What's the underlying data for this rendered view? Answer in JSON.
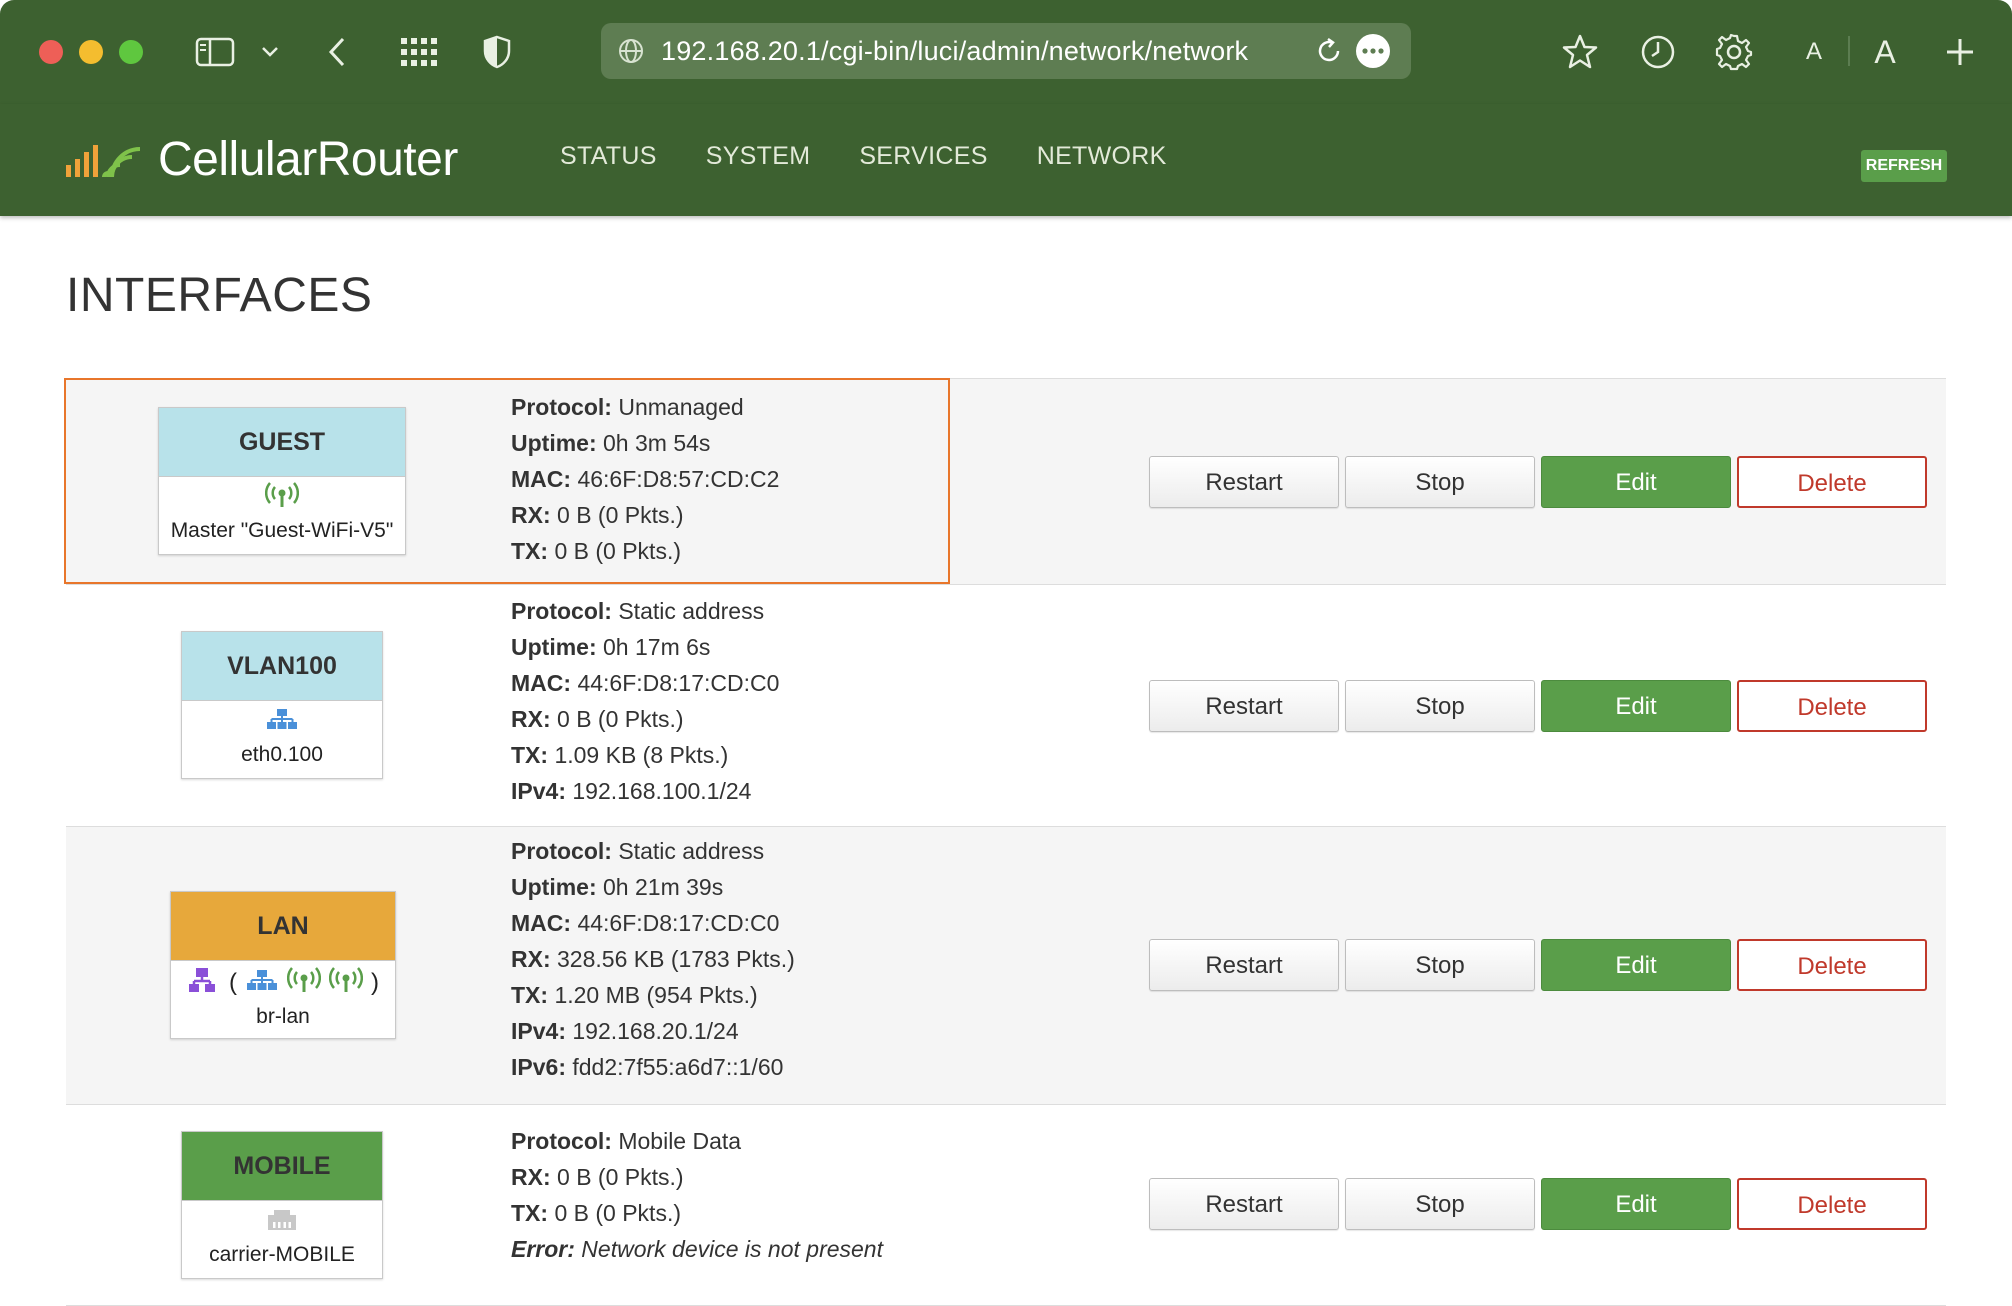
{
  "browser": {
    "url": "192.168.20.1/cgi-bin/luci/admin/network/network",
    "font_small": "A",
    "font_large": "A"
  },
  "app": {
    "brand": "CellularRouter",
    "nav": [
      "STATUS",
      "SYSTEM",
      "SERVICES",
      "NETWORK"
    ],
    "refresh": "REFRESH"
  },
  "page": {
    "title": "INTERFACES"
  },
  "buttons": {
    "restart": "Restart",
    "stop": "Stop",
    "edit": "Edit",
    "delete": "Delete"
  },
  "colors": {
    "header_bg": "#3d6130",
    "guest_head": "#b8e2ea",
    "vlan_head": "#b8e2ea",
    "lan_head": "#e7a83b",
    "mobile_head": "#5a9e4a",
    "edit_btn": "#5a9e4a",
    "delete_btn": "#c0392b",
    "highlight": "#e8762b"
  },
  "interfaces": [
    {
      "name": "GUEST",
      "device": "Master \"Guest-WiFi-V5\"",
      "icons": [
        "wifi-icon"
      ],
      "details": [
        {
          "label": "Protocol:",
          "value": "Unmanaged"
        },
        {
          "label": "Uptime:",
          "value": "0h 3m 54s"
        },
        {
          "label": "MAC:",
          "value": "46:6F:D8:57:CD:C2"
        },
        {
          "label": "RX:",
          "value": "0 B (0 Pkts.)"
        },
        {
          "label": "TX:",
          "value": "0 B (0 Pkts.)"
        }
      ]
    },
    {
      "name": "VLAN100",
      "device": "eth0.100",
      "icons": [
        "network-icon"
      ],
      "details": [
        {
          "label": "Protocol:",
          "value": "Static address"
        },
        {
          "label": "Uptime:",
          "value": "0h 17m 6s"
        },
        {
          "label": "MAC:",
          "value": "44:6F:D8:17:CD:C0"
        },
        {
          "label": "RX:",
          "value": "0 B (0 Pkts.)"
        },
        {
          "label": "TX:",
          "value": "1.09 KB (8 Pkts.)"
        },
        {
          "label": "IPv4:",
          "value": "192.168.100.1/24"
        }
      ]
    },
    {
      "name": "LAN",
      "device": "br-lan",
      "icons": [
        "bridge-icon",
        "network-icon",
        "wifi-icon",
        "wifi-icon"
      ],
      "paren_open": "(",
      "paren_close": ")",
      "details": [
        {
          "label": "Protocol:",
          "value": "Static address"
        },
        {
          "label": "Uptime:",
          "value": "0h 21m 39s"
        },
        {
          "label": "MAC:",
          "value": "44:6F:D8:17:CD:C0"
        },
        {
          "label": "RX:",
          "value": "328.56 KB (1783 Pkts.)"
        },
        {
          "label": "TX:",
          "value": "1.20 MB (954 Pkts.)"
        },
        {
          "label": "IPv4:",
          "value": "192.168.20.1/24"
        },
        {
          "label": "IPv6:",
          "value": "fdd2:7f55:a6d7::1/60"
        }
      ]
    },
    {
      "name": "MOBILE",
      "device": "carrier-MOBILE",
      "icons": [
        "ethernet-port-icon"
      ],
      "details": [
        {
          "label": "Protocol:",
          "value": "Mobile Data"
        },
        {
          "label": "RX:",
          "value": "0 B (0 Pkts.)"
        },
        {
          "label": "TX:",
          "value": "0 B (0 Pkts.)"
        }
      ],
      "error": {
        "label": "Error:",
        "value": "Network device is not present"
      }
    }
  ]
}
